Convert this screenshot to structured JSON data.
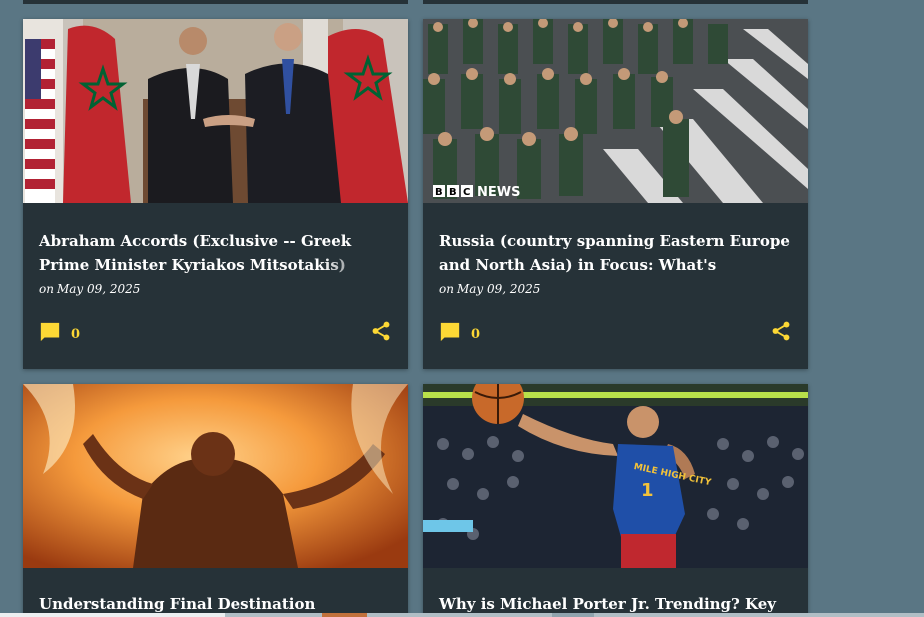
{
  "cards": [
    {
      "title": "Abraham Accords (Exclusive -- Greek Prime Minister Kyriakos Mitsotakis) Deep Dive: What's Happening",
      "date_prefix": "on",
      "date": "May 09, 2025",
      "comment_count": "0",
      "image": "diplomats-handshake-flags"
    },
    {
      "title": "Russia (country spanning Eastern Europe and North Asia) in Focus: What's Happening Now",
      "date_prefix": "on",
      "date": "May 09, 2025",
      "comment_count": "0",
      "image": "military-parade",
      "image_caption": "BBC NEWS"
    },
    {
      "title": "Understanding Final Destination",
      "image": "fire-explosion"
    },
    {
      "title": "Why is Michael Porter Jr. Trending? Key",
      "image": "basketball-player",
      "jersey_text": "MILE HIGH CITY",
      "jersey_number": "1"
    }
  ],
  "colors": {
    "background": "#5a7684",
    "card": "#263238",
    "accent": "#fdd835",
    "text": "#ffffff"
  },
  "icons": {
    "comment": "comment-icon",
    "share": "share-icon"
  }
}
